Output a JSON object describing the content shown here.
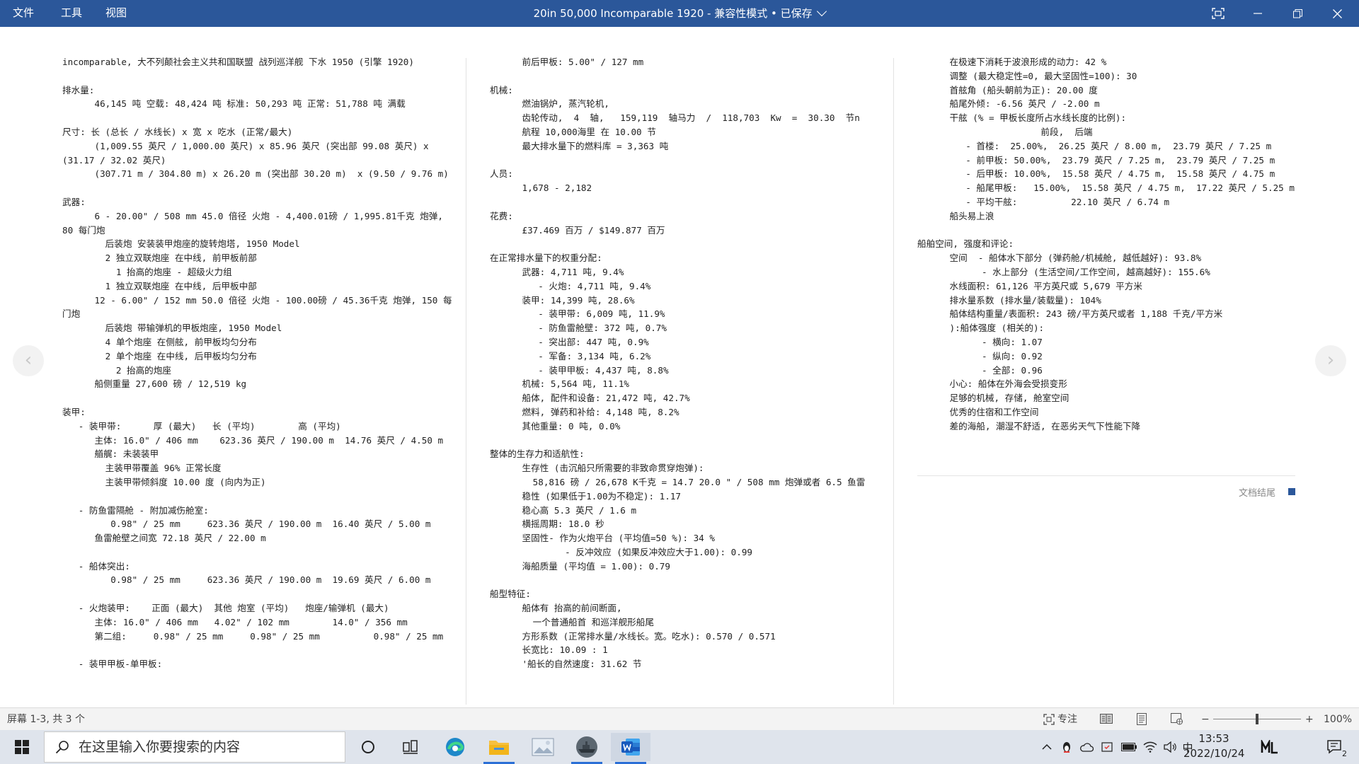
{
  "window": {
    "menu": [
      "文件",
      "工具",
      "视图"
    ],
    "title": "20in 50,000 Incomparable 1920",
    "title_suffix": " - 兼容性模式 • 已保存 ",
    "accent": "#2b579a"
  },
  "document": {
    "columns": [
      [
        "incomparable, 大不列颠社会主义共和国联盟 战列巡洋舰 下水 1950 (引擎 1920)",
        "",
        "排水量:",
        "      46,145 吨 空载: 48,424 吨 标准: 50,293 吨 正常: 51,788 吨 满载",
        "",
        "尺寸: 长 (总长 / 水线长) x 宽 x 吃水 (正常/最大)",
        "      (1,009.55 英尺 / 1,000.00 英尺) x 85.96 英尺 (突出部 99.08 英尺) x",
        "(31.17 / 32.02 英尺)",
        "      (307.71 m / 304.80 m) x 26.20 m (突出部 30.20 m)  x (9.50 / 9.76 m)",
        "",
        "武器:",
        "      6 - 20.00\" / 508 mm 45.0 倍径 火炮 - 4,400.01磅 / 1,995.81千克 炮弹,",
        "80 每门炮",
        "        后装炮 安装装甲炮座的旋转炮塔, 1950 Model",
        "        2 独立双联炮座 在中线, 前甲板前部",
        "          1 抬高的炮座 - 超级火力组",
        "        1 独立双联炮座 在中线, 后甲板中部",
        "      12 - 6.00\" / 152 mm 50.0 倍径 火炮 - 100.00磅 / 45.36千克 炮弹, 150 每",
        "门炮",
        "        后装炮 带输弹机的甲板炮座, 1950 Model",
        "        4 单个炮座 在侧舷, 前甲板均匀分布",
        "        2 单个炮座 在中线, 后甲板均匀分布",
        "          2 抬高的炮座",
        "      船侧重量 27,600 磅 / 12,519 kg",
        "",
        "装甲:",
        "   - 装甲带:      厚 (最大)   长 (平均)        高 (平均)",
        "      主体: 16.0\" / 406 mm    623.36 英尺 / 190.00 m  14.76 英尺 / 4.50 m",
        "      艏艉: 未装装甲",
        "        主装甲带覆盖 96% 正常长度",
        "        主装甲带倾斜度 10.00 度 (向内为正)",
        "",
        "   - 防鱼雷隔舱 - 附加减伤舱室:",
        "         0.98\" / 25 mm     623.36 英尺 / 190.00 m  16.40 英尺 / 5.00 m",
        "      鱼雷舱壁之间宽 72.18 英尺 / 22.00 m",
        "",
        "   - 船体突出:",
        "         0.98\" / 25 mm     623.36 英尺 / 190.00 m  19.69 英尺 / 6.00 m",
        "",
        "   - 火炮装甲:    正面 (最大)  其他 炮室 (平均)   炮座/输弹机 (最大)",
        "      主体: 16.0\" / 406 mm   4.02\" / 102 mm        14.0\" / 356 mm",
        "      第二组:     0.98\" / 25 mm     0.98\" / 25 mm          0.98\" / 25 mm",
        "",
        "   - 装甲甲板-单甲板:"
      ],
      [
        "      前后甲板: 5.00\" / 127 mm",
        "",
        "机械:",
        "      燃油锅炉, 蒸汽轮机,",
        "      齿轮传动,  4  轴,   159,119  轴马力  /  118,703  Kw  =  30.30  节n",
        "      航程 10,000海里 在 10.00 节",
        "      最大排水量下的燃料库 = 3,363 吨",
        "",
        "人员:",
        "      1,678 - 2,182",
        "",
        "花费:",
        "      £37.469 百万 / $149.877 百万",
        "",
        "在正常排水量下的权重分配:",
        "      武器: 4,711 吨, 9.4%",
        "         - 火炮: 4,711 吨, 9.4%",
        "      装甲: 14,399 吨, 28.6%",
        "         - 装甲带: 6,009 吨, 11.9%",
        "         - 防鱼雷舱壁: 372 吨, 0.7%",
        "         - 突出部: 447 吨, 0.9%",
        "         - 军备: 3,134 吨, 6.2%",
        "         - 装甲甲板: 4,437 吨, 8.8%",
        "      机械: 5,564 吨, 11.1%",
        "      船体, 配件和设备: 21,472 吨, 42.7%",
        "      燃料, 弹药和补给: 4,148 吨, 8.2%",
        "      其他重量: 0 吨, 0.0%",
        "",
        "整体的生存力和适航性:",
        "      生存性 (击沉船只所需要的非致命贯穿炮弹):",
        "        58,816 磅 / 26,678 K千克 = 14.7 20.0 \" / 508 mm 炮弹或者 6.5 鱼雷",
        "      稳性 (如果低于1.00为不稳定): 1.17",
        "      稳心高 5.3 英尺 / 1.6 m",
        "      横摇周期: 18.0 秒",
        "      坚固性- 作为火炮平台 (平均值=50 %): 34 %",
        "              - 反冲效应 (如果反冲效应大于1.00): 0.99",
        "      海船质量 (平均值 = 1.00): 0.79",
        "",
        "船型特征:",
        "      船体有 抬高的前间断面,",
        "        一个普通船首 和巡洋舰形船尾",
        "      方形系数 (正常排水量/水线长。宽。吃水): 0.570 / 0.571",
        "      长宽比: 10.09 : 1",
        "      '船长的自然速度: 31.62 节"
      ],
      [
        "      在极速下消耗于波浪形成的动力: 42 %",
        "      调整 (最大稳定性=0, 最大坚固性=100): 30",
        "      首舷角 (船头朝前为正): 20.00 度",
        "      船尾外倾: -6.56 英尺 / -2.00 m",
        "      干舷 (% = 甲板长度所占水线长度的比例):",
        "                       前段,  后端",
        "         - 首楼:  25.00%,  26.25 英尺 / 8.00 m,  23.79 英尺 / 7.25 m",
        "         - 前甲板: 50.00%,  23.79 英尺 / 7.25 m,  23.79 英尺 / 7.25 m",
        "         - 后甲板: 10.00%,  15.58 英尺 / 4.75 m,  15.58 英尺 / 4.75 m",
        "         - 船尾甲板:   15.00%,  15.58 英尺 / 4.75 m,  17.22 英尺 / 5.25 m",
        "         - 平均干舷:          22.10 英尺 / 6.74 m",
        "      船头易上浪",
        "",
        "船舶空间, 强度和评论:",
        "      空间  - 船体水下部分 (弹药舱/机械舱, 越低越好): 93.8%",
        "            - 水上部分 (生活空间/工作空间, 越高越好): 155.6%",
        "      水线面积: 61,126 平方英尺或 5,679 平方米",
        "      排水量系数 (排水量/装载量): 104%",
        "      船体结构重量/表面积: 243 磅/平方英尺或者 1,188 千克/平方米",
        "      ):船体强度 (相关的):",
        "            - 横向: 1.07",
        "            - 纵向: 0.92",
        "            - 全部: 0.96",
        "      小心: 船体在外海会受损变形",
        "      足够的机械, 存储, 舱室空间",
        "      优秀的住宿和工作空间",
        "      差的海船, 潮湿不舒适, 在恶劣天气下性能下降"
      ]
    ],
    "end_label": "文档结尾"
  },
  "statusbar": {
    "page_info": "屏幕 1-3, 共 3 个",
    "focus": "专注",
    "zoom": "100%",
    "zoom_level": 1.0
  },
  "taskbar": {
    "search_placeholder": "在这里输入你要搜索的内容",
    "ime": "中",
    "time": "13:53",
    "date": "2022/10/24",
    "notification_count": "2"
  }
}
